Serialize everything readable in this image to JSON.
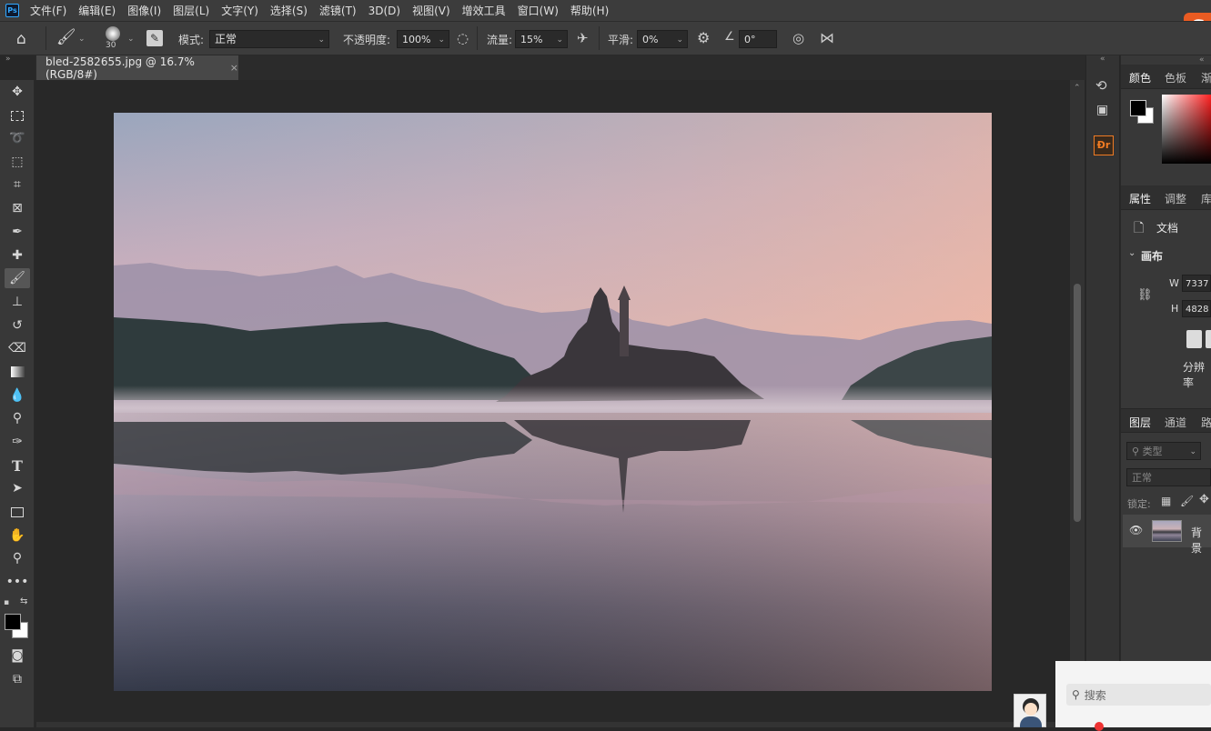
{
  "menubar": {
    "logo": "Ps",
    "items": [
      "文件(F)",
      "编辑(E)",
      "图像(I)",
      "图层(L)",
      "文字(Y)",
      "选择(S)",
      "滤镜(T)",
      "3D(D)",
      "视图(V)",
      "增效工具",
      "窗口(W)",
      "帮助(H)"
    ]
  },
  "sogou": {
    "label": "S"
  },
  "options": {
    "brush_size": "30",
    "mode_label": "模式:",
    "mode_value": "正常",
    "opacity_label": "不透明度:",
    "opacity_value": "100%",
    "flow_label": "流量:",
    "flow_value": "15%",
    "smooth_label": "平滑:",
    "smooth_value": "0%",
    "angle_value": "0°"
  },
  "document": {
    "tab_title": "bled-2582655.jpg @ 16.7%(RGB/8#)",
    "close": "×"
  },
  "right": {
    "color_tabs": [
      "颜色",
      "色板",
      "渐"
    ],
    "props_tabs": [
      "属性",
      "调整",
      "库"
    ],
    "doc_label": "文档",
    "canvas_label": "画布",
    "width_label": "W",
    "width_value": "7337",
    "height_label": "H",
    "height_value": "4828",
    "resolution_label": "分辨率",
    "layers_tabs": [
      "图层",
      "通道",
      "路"
    ],
    "type_filter": "类型",
    "blend_mode": "正常",
    "lock_label": "锁定:",
    "layer_name": "背景"
  },
  "taskbar": {
    "search_placeholder": "搜索"
  },
  "colors": {
    "accent_orange": "#e95b22",
    "dr_orange": "#f07b23",
    "foreground": "#000000",
    "background": "#ffffff"
  }
}
